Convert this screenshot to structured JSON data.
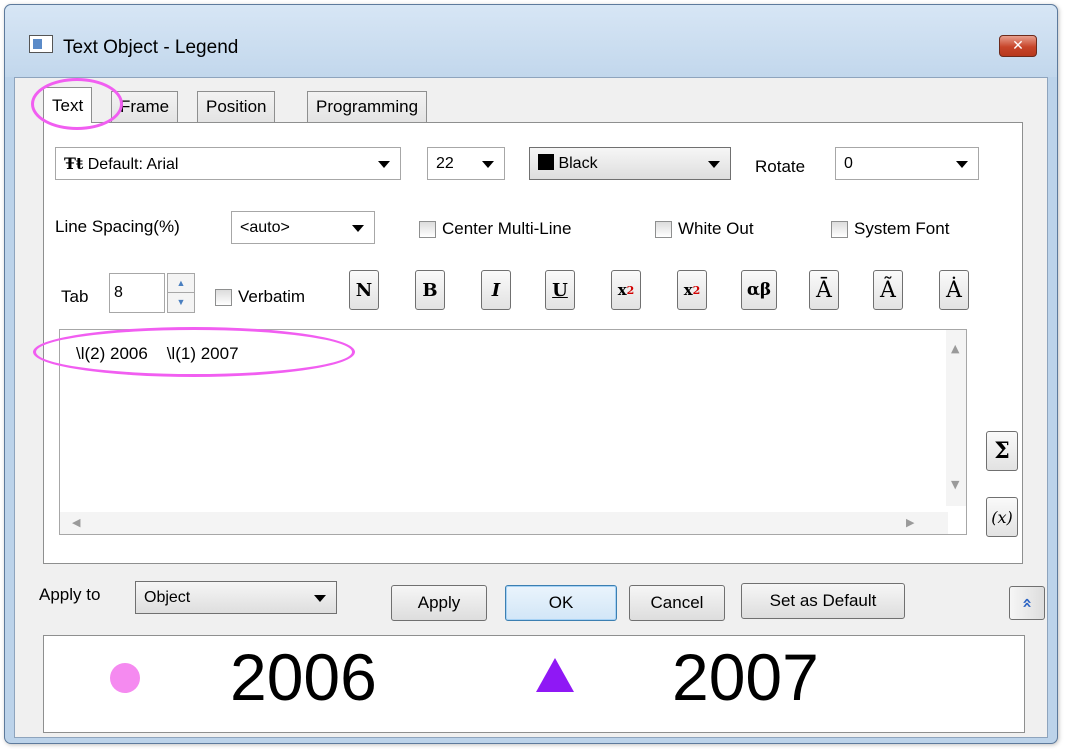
{
  "window": {
    "title": "Text Object - Legend",
    "close_glyph": "✕"
  },
  "tabs": [
    {
      "label": "Text",
      "active": true
    },
    {
      "label": "Frame",
      "active": false
    },
    {
      "label": "Position",
      "active": false
    },
    {
      "label": "Programming",
      "active": false
    }
  ],
  "font": {
    "icon": "font-tt-icon",
    "value": "Default: Arial"
  },
  "size": {
    "value": "22"
  },
  "color": {
    "value": "Black",
    "swatch": "#000000"
  },
  "rotate": {
    "label": "Rotate",
    "value": "0"
  },
  "line_spacing": {
    "label": "Line Spacing(%)",
    "value": "<auto>"
  },
  "checkboxes": {
    "center_multiline": {
      "label": "Center Multi-Line",
      "checked": false
    },
    "white_out": {
      "label": "White Out",
      "checked": false
    },
    "system_font": {
      "label": "System Font",
      "checked": false
    },
    "verbatim": {
      "label": "Verbatim",
      "checked": false
    }
  },
  "tab": {
    "label": "Tab",
    "value": "8"
  },
  "format_buttons": {
    "normal": "N",
    "bold": "B",
    "italic": "I",
    "underline": "U",
    "superscript_base": "x",
    "superscript_mark": "2",
    "subscript_base": "x",
    "subscript_mark": "2",
    "greek": "αβ",
    "overbar": "Ā",
    "tilde": "Ã",
    "dot": "Ȧ"
  },
  "editor": {
    "text": "\\l(2) 2006    \\l(1) 2007"
  },
  "side_buttons": {
    "sigma": "Σ",
    "variable": "(x)"
  },
  "apply_to": {
    "label": "Apply to",
    "value": "Object"
  },
  "buttons": {
    "apply": "Apply",
    "ok": "OK",
    "cancel": "Cancel",
    "set_default": "Set as Default",
    "collapse": "»"
  },
  "preview": {
    "items": [
      {
        "label": "2006",
        "symbol": "circle",
        "color": "#f58af0"
      },
      {
        "label": "2007",
        "symbol": "triangle",
        "color": "#8f18f5"
      }
    ]
  },
  "colors": {
    "highlight": "#f15ef1"
  }
}
